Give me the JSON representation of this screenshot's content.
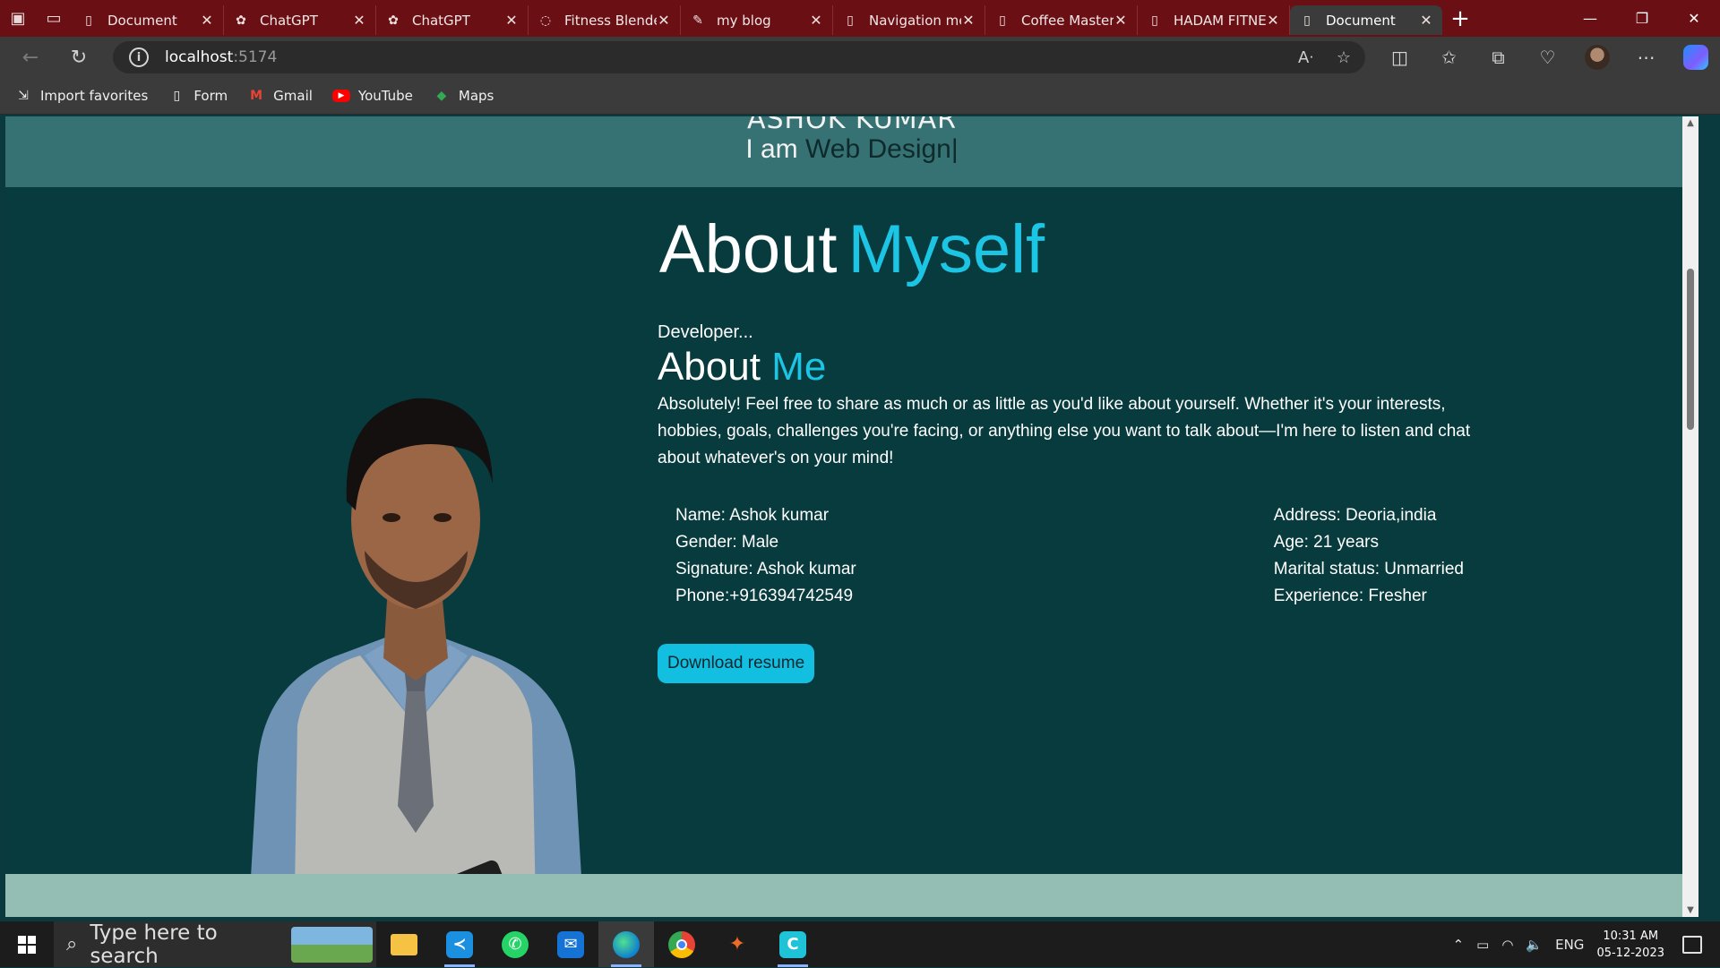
{
  "browser": {
    "tabs": [
      {
        "title": "Document",
        "icon": "page-icon"
      },
      {
        "title": "ChatGPT",
        "icon": "chatgpt-icon"
      },
      {
        "title": "ChatGPT",
        "icon": "chatgpt-icon"
      },
      {
        "title": "Fitness Blender",
        "icon": "loading-icon"
      },
      {
        "title": "my blog",
        "icon": "blog-icon"
      },
      {
        "title": "Navigation menu",
        "icon": "page-icon"
      },
      {
        "title": "Coffee Master",
        "icon": "page-icon"
      },
      {
        "title": "HADAM FITNESS",
        "icon": "page-icon"
      },
      {
        "title": "Document",
        "icon": "page-icon",
        "active": true
      }
    ],
    "close_glyph": "✕",
    "new_tab_glyph": "+",
    "url_host": "localhost",
    "url_port": ":5174",
    "favorites": [
      {
        "label": "Import favorites",
        "icon": "import-icon"
      },
      {
        "label": "Form",
        "icon": "page-icon"
      },
      {
        "label": "Gmail",
        "icon": "gmail-icon"
      },
      {
        "label": "YouTube",
        "icon": "youtube-icon"
      },
      {
        "label": "Maps",
        "icon": "maps-icon"
      }
    ]
  },
  "page": {
    "hero_name": "ASHOK KUMAR",
    "hero_role_prefix": "I am ",
    "hero_role_typed": "Web Design",
    "hero_caret": "|",
    "section_title_main": "About",
    "section_title_accent": "Myself",
    "subtitle": "Developer...",
    "about_main": "About",
    "about_accent": "Me",
    "paragraph": "Absolutely! Feel free to share as much or as little as you'd like about yourself. Whether it's your interests, hobbies, goals, challenges you're facing, or anything else you want to talk about—I'm here to listen and chat about whatever's on your mind!",
    "details_left": [
      "Name: Ashok kumar",
      "Gender: Male",
      "Signature: Ashok kumar",
      "Phone:+916394742549"
    ],
    "details_right": [
      "Address: Deoria,india",
      "Age: 21 years",
      "Marital status: Unmarried",
      "Experience: Fresher"
    ],
    "download_button": "Download resume",
    "accent_color": "#1cc5e4",
    "bg_color": "#083b3e",
    "header_band_color": "#367274",
    "footer_band_color": "#94bdb3"
  },
  "taskbar": {
    "search_placeholder": "Type here to search",
    "apps": [
      "file-explorer-icon",
      "vscode-icon",
      "whatsapp-icon",
      "mail-icon",
      "edge-icon",
      "chrome-icon",
      "figma-icon",
      "canva-icon"
    ],
    "language": "ENG",
    "time": "10:31 AM",
    "date": "05-12-2023"
  }
}
